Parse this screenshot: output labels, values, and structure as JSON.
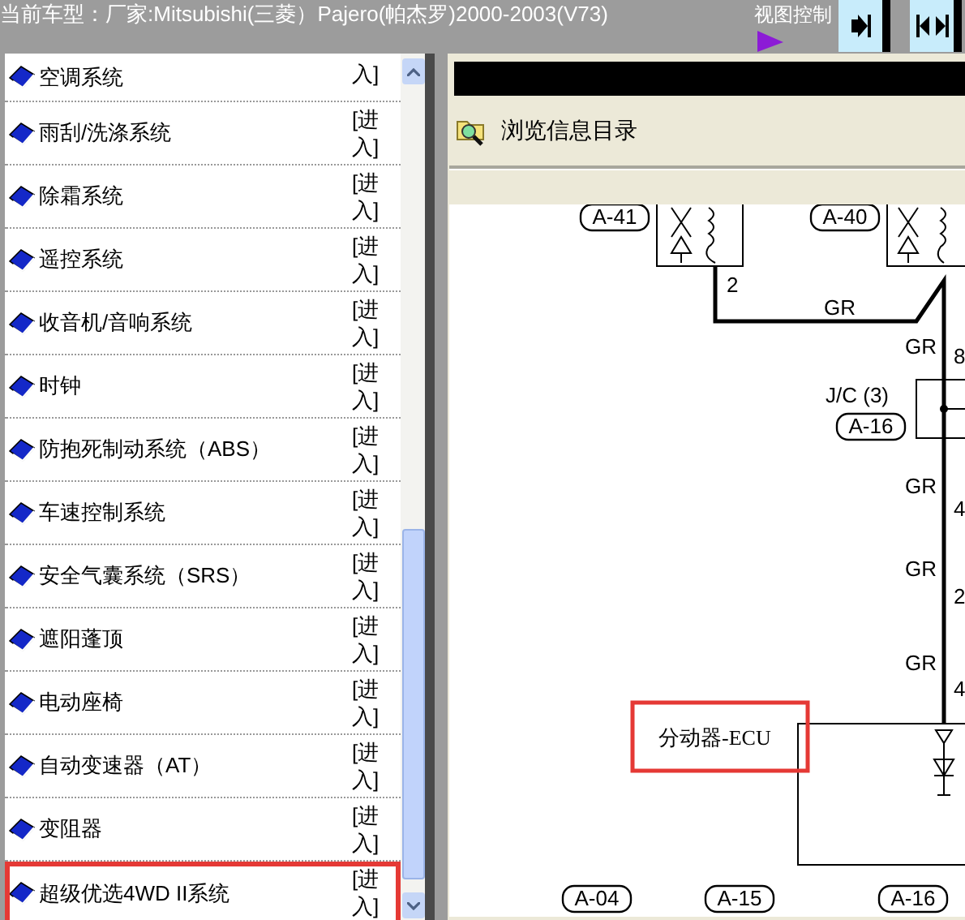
{
  "header": {
    "title": "当前车型：厂家:Mitsubishi(三菱）Pajero(帕杰罗)2000-2003(V73)",
    "view_control": {
      "label": "视图控制"
    }
  },
  "sidebar": {
    "items": [
      {
        "label": "空调系统",
        "action": "入]",
        "selected": false
      },
      {
        "label": "雨刮/洗涤系统",
        "action": "[进入]",
        "selected": false
      },
      {
        "label": "除霜系统",
        "action": "[进入]",
        "selected": false
      },
      {
        "label": "遥控系统",
        "action": "[进入]",
        "selected": false
      },
      {
        "label": "收音机/音响系统",
        "action": "[进入]",
        "selected": false
      },
      {
        "label": "时钟",
        "action": "[进入]",
        "selected": false
      },
      {
        "label": "防抱死制动系统（ABS）",
        "action": "[进入]",
        "selected": false
      },
      {
        "label": "车速控制系统",
        "action": "[进入]",
        "selected": false
      },
      {
        "label": "安全气囊系统（SRS）",
        "action": "[进入]",
        "selected": false
      },
      {
        "label": "遮阳蓬顶",
        "action": "[进入]",
        "selected": false
      },
      {
        "label": "电动座椅",
        "action": "[进入]",
        "selected": false
      },
      {
        "label": "自动变速器（AT）",
        "action": "[进入]",
        "selected": false
      },
      {
        "label": "变阻器",
        "action": "[进入]",
        "selected": false
      },
      {
        "label": "超级优选4WD II系统",
        "action": "[进入]",
        "selected": true
      }
    ]
  },
  "content": {
    "toolbar": {
      "label": "浏览信息目录"
    },
    "diagram": {
      "top_connectors": [
        "A-41",
        "A-40"
      ],
      "pins": [
        "2",
        "8",
        "4",
        "2",
        "4"
      ],
      "wire_colors": [
        "GR",
        "GR",
        "GR",
        "GR",
        "GR"
      ],
      "junction": {
        "name": "J/C (3)",
        "connector": "A-16"
      },
      "ecu": {
        "label": "分动器-ECU",
        "highlighted": true
      },
      "bottom_connectors": [
        "A-04",
        "A-15",
        "A-16"
      ]
    }
  }
}
